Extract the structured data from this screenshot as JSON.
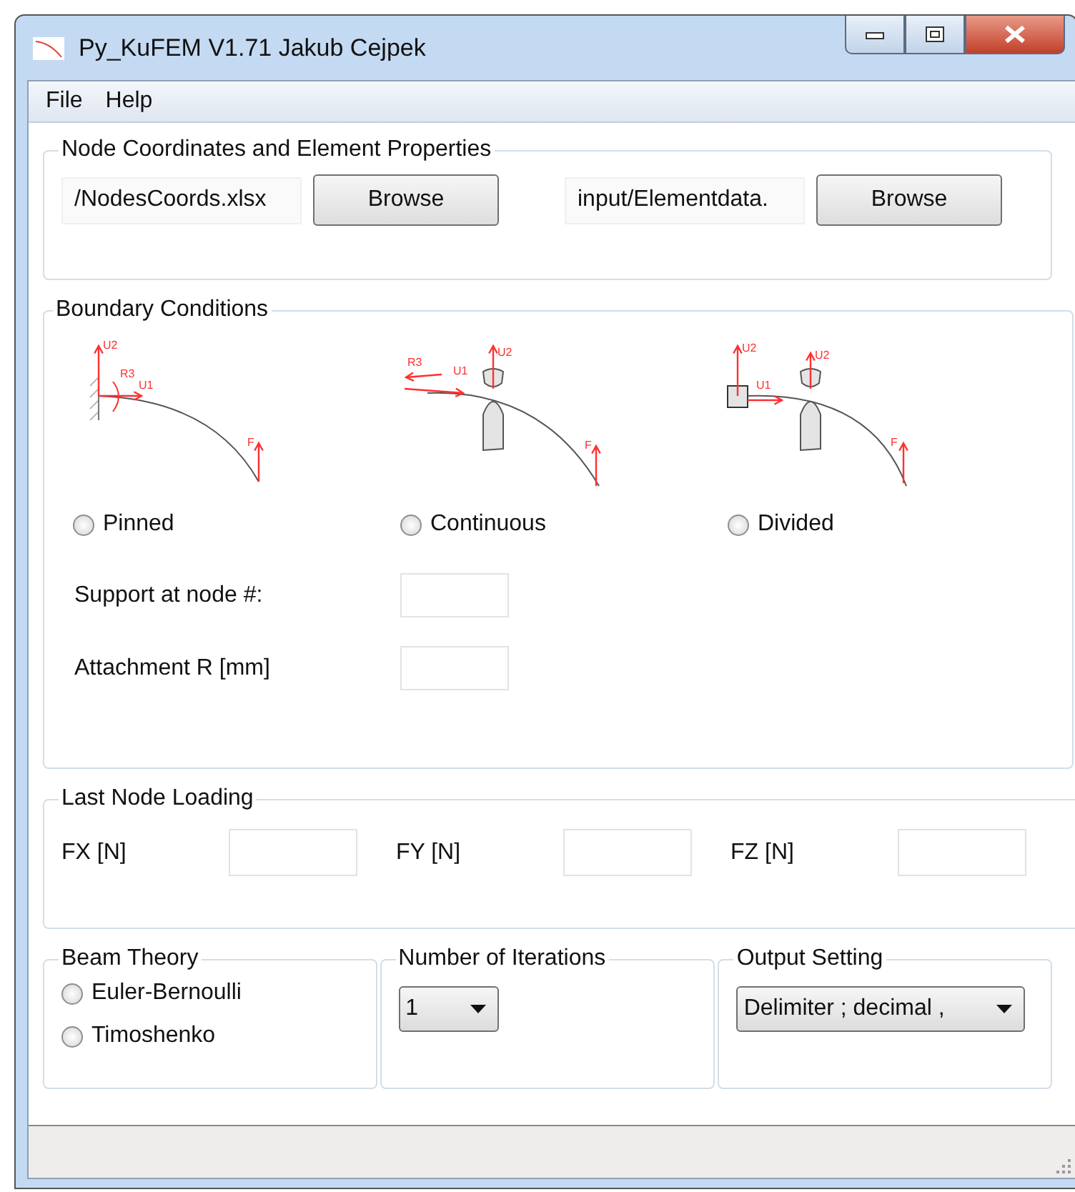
{
  "window": {
    "title": "Py_KuFEM V1.71 Jakub Cejpek"
  },
  "menu": [
    {
      "label": "File"
    },
    {
      "label": "Help"
    }
  ],
  "node_coordinates": {
    "title": "Node Coordinates and Element Properties",
    "files": [
      {
        "value": "/NodesCoords.xlsx",
        "button": "Browse"
      },
      {
        "value": "input/Elementdata.",
        "button": "Browse"
      }
    ]
  },
  "boundary_conditions": {
    "title": "Boundary Conditions",
    "options": [
      {
        "kind": "pinned",
        "label": "Pinned",
        "selected": false,
        "diagram_labels": [
          "U2",
          "R3",
          "U1",
          "F"
        ]
      },
      {
        "kind": "continuous",
        "label": "Continuous",
        "selected": false,
        "diagram_labels": [
          "R3",
          "U1",
          "U2",
          "F"
        ]
      },
      {
        "kind": "divided",
        "label": "Divided",
        "selected": false,
        "diagram_labels": [
          "U2",
          "U1",
          "U2",
          "F"
        ]
      }
    ],
    "fields": [
      {
        "label": "Support at node #:"
      },
      {
        "label": "Attachment R [mm]"
      }
    ]
  },
  "last_node_loading": {
    "title": "Last Node Loading",
    "fields": [
      {
        "label": "FX [N]"
      },
      {
        "label": "FY [N]"
      },
      {
        "label": "FZ [N]"
      }
    ]
  },
  "beam_theory": {
    "title": "Beam Theory",
    "options": [
      {
        "label": "Euler-Bernoulli",
        "selected": false
      },
      {
        "label": "Timoshenko",
        "selected": false
      }
    ]
  },
  "iterations": {
    "title": "Number of Iterations",
    "value": "1"
  },
  "output_setting": {
    "title": "Output Setting",
    "value": "Delimiter ; decimal ,"
  }
}
